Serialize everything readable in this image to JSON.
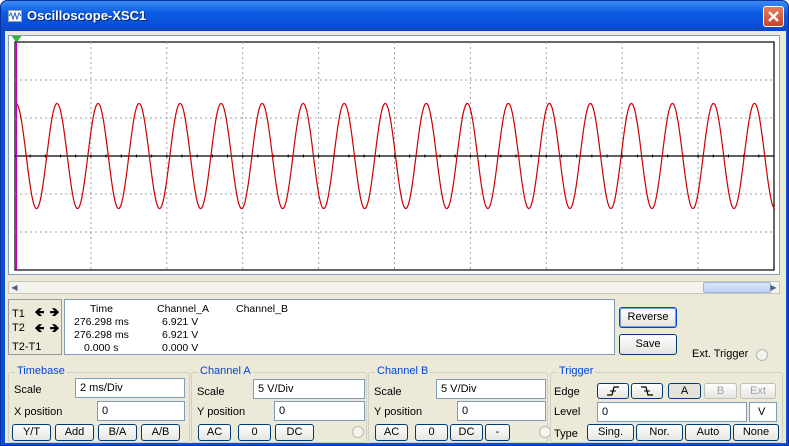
{
  "window": {
    "title": "Oscilloscope-XSC1"
  },
  "cursors": {
    "t1": "T1",
    "t2": "T2",
    "diff": "T2-T1"
  },
  "readout": {
    "headers": {
      "time": "Time",
      "channel_a": "Channel_A",
      "channel_b": "Channel_B"
    },
    "rows": [
      {
        "time": "276.298 ms",
        "a": "6.921 V"
      },
      {
        "time": "276.298 ms",
        "a": "6.921 V"
      },
      {
        "time": "0.000 s",
        "a": "0.000 V"
      }
    ]
  },
  "buttons": {
    "reverse": "Reverse",
    "save": "Save"
  },
  "ext_trigger": {
    "label": "Ext. Trigger"
  },
  "timebase": {
    "title": "Timebase",
    "scale_label": "Scale",
    "scale_value": "2 ms/Div",
    "xpos_label": "X position",
    "xpos_value": "0",
    "modes": [
      "Y/T",
      "Add",
      "B/A",
      "A/B"
    ]
  },
  "channel_a": {
    "title": "Channel A",
    "scale_label": "Scale",
    "scale_value": "5  V/Div",
    "ypos_label": "Y position",
    "ypos_value": "0",
    "coupling": [
      "AC",
      "0",
      "DC"
    ]
  },
  "channel_b": {
    "title": "Channel B",
    "scale_label": "Scale",
    "scale_value": "5  V/Div",
    "ypos_label": "Y position",
    "ypos_value": "0",
    "coupling": [
      "AC",
      "0",
      "DC",
      "-"
    ]
  },
  "trigger": {
    "title": "Trigger",
    "edge_label": "Edge",
    "sources": [
      "A",
      "B",
      "Ext"
    ],
    "level_label": "Level",
    "level_value": "0",
    "level_unit": "V",
    "type_label": "Type",
    "types": [
      "Sing.",
      "Nor.",
      "Auto",
      "None"
    ]
  },
  "waveform": {
    "color": "#cc0000",
    "amplitude_divisions": 1.385,
    "cycles_visible": 18.5,
    "start_phase": 0.25
  },
  "colors": {
    "grid": "#a0a0a0",
    "trace": "#cc0000",
    "cursor": "#c000c0",
    "accent": "#0046d5"
  }
}
